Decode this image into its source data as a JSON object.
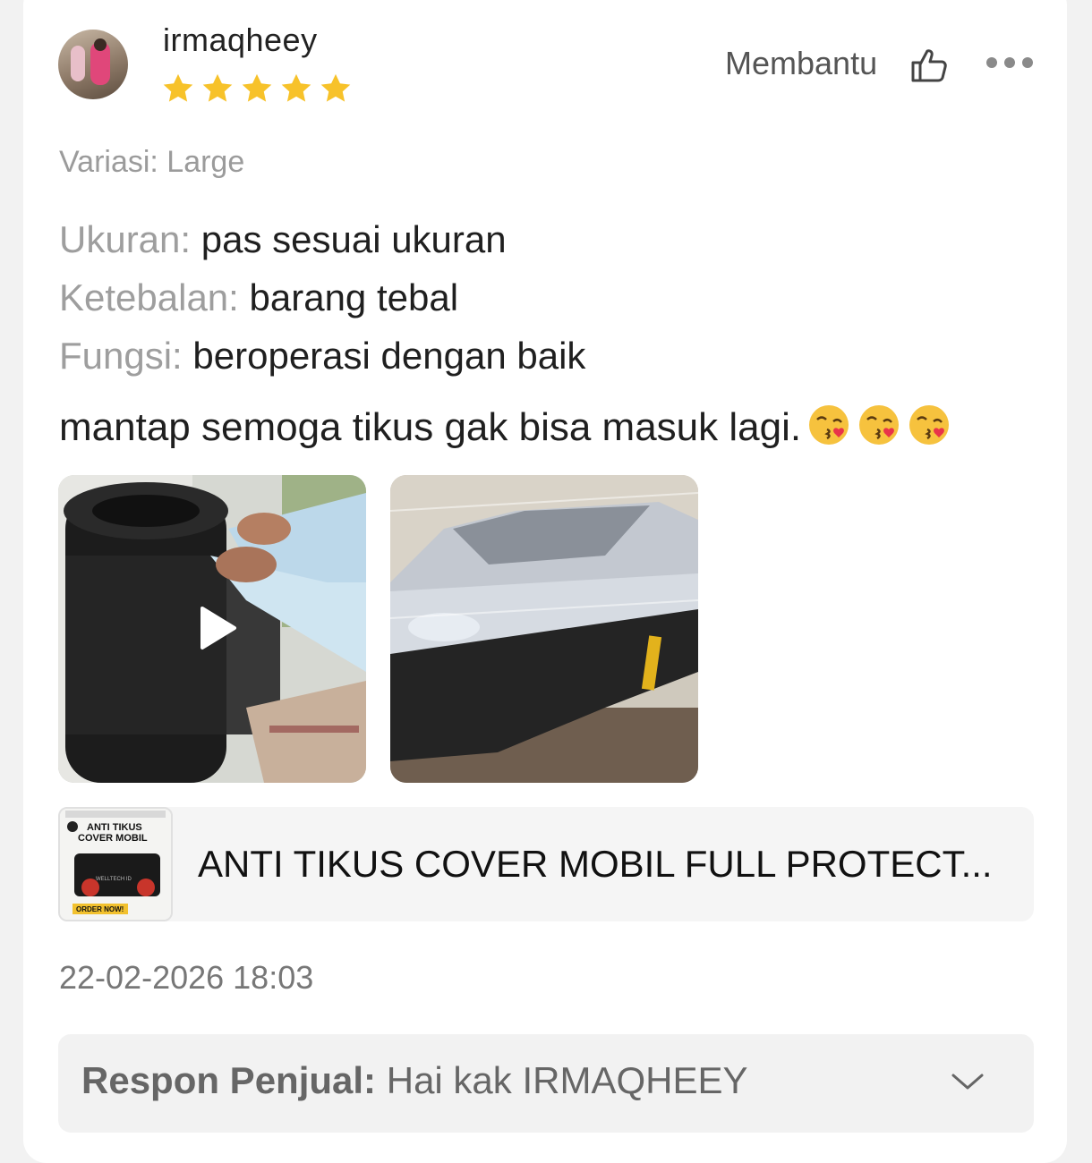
{
  "review": {
    "username": "irmaqheey",
    "rating": 5,
    "helpful_label": "Membantu",
    "variant": "Variasi: Large",
    "attributes": [
      {
        "key": "Ukuran:",
        "value": "pas sesuai ukuran"
      },
      {
        "key": "Ketebalan:",
        "value": "barang tebal"
      },
      {
        "key": "Fungsi:",
        "value": "beroperasi dengan baik"
      }
    ],
    "comment": "mantap semoga tikus gak bisa masuk lagi.",
    "emoji_count": 3,
    "media": [
      {
        "kind": "video",
        "icon": "play-icon"
      },
      {
        "kind": "photo"
      }
    ],
    "date": "22-02-2026 18:03"
  },
  "product": {
    "title": "ANTI TIKUS COVER MOBIL FULL PROTECT...",
    "thumb_text": {
      "line1": "ANTI TIKUS",
      "line2": "COVER MOBIL",
      "brand": "WELLTECH ID",
      "cta": "ORDER NOW!"
    }
  },
  "seller_reply": {
    "label": "Respon Penjual:",
    "text": "Hai kak IRMAQHEEY"
  },
  "colors": {
    "star": "#f7c22a",
    "background": "#f2f2f2",
    "card": "#ffffff"
  }
}
